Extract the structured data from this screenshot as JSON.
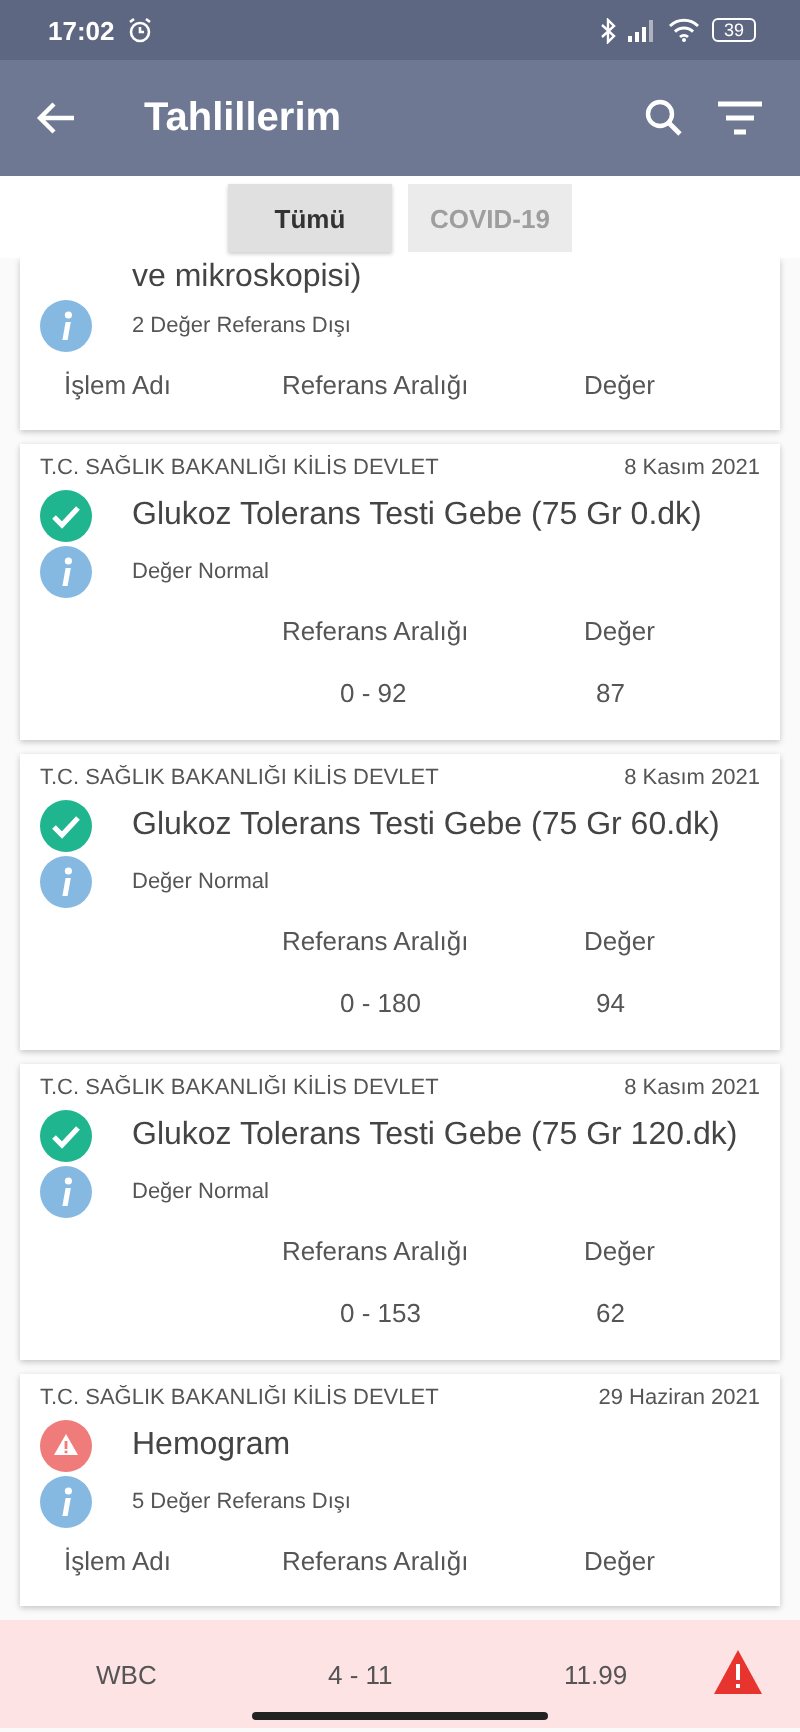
{
  "status_bar": {
    "time": "17:02",
    "battery": "39"
  },
  "app_bar": {
    "title": "Tahlillerim"
  },
  "tabs": [
    {
      "label": "Tümü",
      "selected": true
    },
    {
      "label": "COVID-19",
      "selected": false
    }
  ],
  "results": [
    {
      "kind": "partial",
      "title": "ve mikroskopisi)",
      "summary": "2 Değer Referans Dışı",
      "columns": [
        "İşlem Adı",
        "Referans Aralığı",
        "Değer"
      ]
    },
    {
      "kind": "normal",
      "institution": "T.C. SAĞLIK BAKANLIĞI KİLİS DEVLET",
      "date": "8 Kasım 2021",
      "title": "Glukoz Tolerans Testi Gebe (75 Gr 0.dk)",
      "summary": "Değer Normal",
      "columns": [
        "Referans Aralığı",
        "Değer"
      ],
      "rows": [
        {
          "cells": [
            "0 - 92",
            "87"
          ]
        }
      ]
    },
    {
      "kind": "normal",
      "institution": "T.C. SAĞLIK BAKANLIĞI KİLİS DEVLET",
      "date": "8 Kasım 2021",
      "title": "Glukoz Tolerans Testi Gebe (75 Gr 60.dk)",
      "summary": "Değer Normal",
      "columns": [
        "Referans Aralığı",
        "Değer"
      ],
      "rows": [
        {
          "cells": [
            "0 - 180",
            "94"
          ]
        }
      ]
    },
    {
      "kind": "normal",
      "institution": "T.C. SAĞLIK BAKANLIĞI KİLİS DEVLET",
      "date": "8 Kasım 2021",
      "title": "Glukoz Tolerans Testi Gebe (75 Gr 120.dk)",
      "summary": "Değer Normal",
      "columns": [
        "Referans Aralığı",
        "Değer"
      ],
      "rows": [
        {
          "cells": [
            "0 - 153",
            "62"
          ]
        }
      ]
    },
    {
      "kind": "abnormal",
      "institution": "T.C. SAĞLIK BAKANLIĞI KİLİS DEVLET",
      "date": "29 Haziran 2021",
      "title": "Hemogram",
      "summary": "5 Değer Referans Dışı",
      "columns": [
        "İşlem Adı",
        "Referans Aralığı",
        "Değer"
      ],
      "rows": [
        {
          "cells": [
            "WBC",
            "4 - 11",
            "11.99"
          ],
          "flagged": true
        }
      ]
    }
  ]
}
